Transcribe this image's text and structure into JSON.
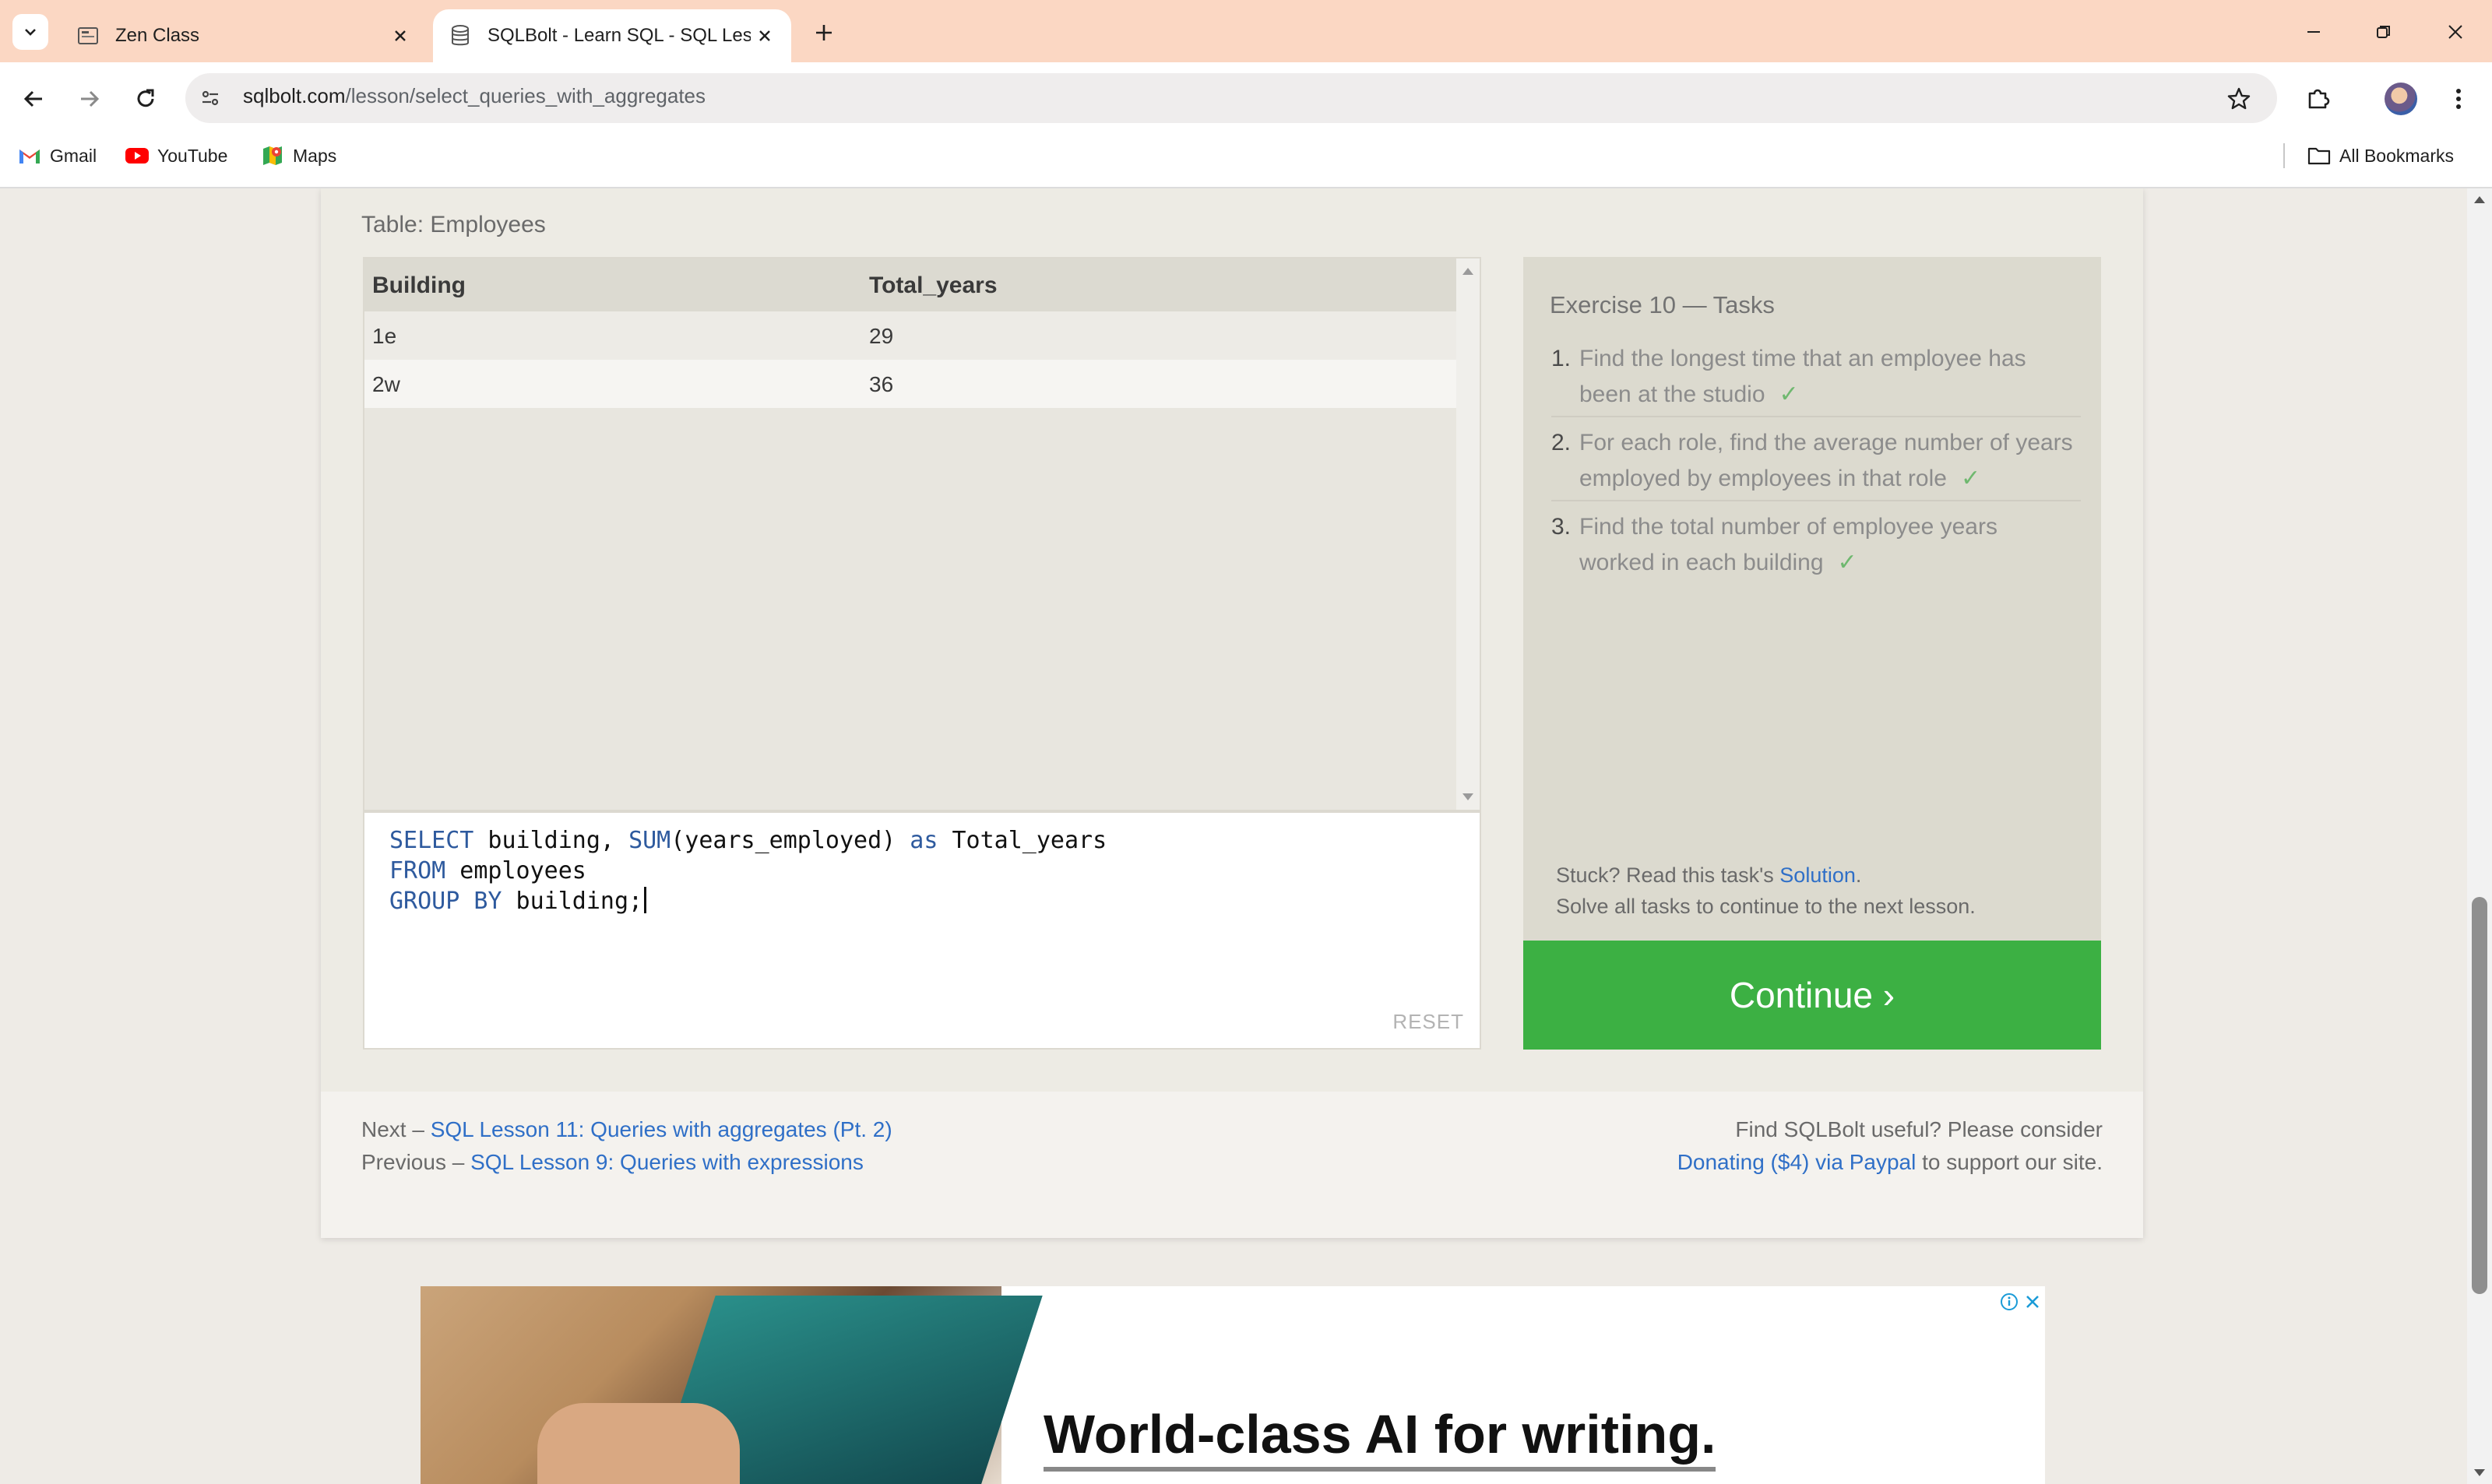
{
  "browser": {
    "tabs": [
      {
        "title": "Zen Class",
        "icon": "zen-class-favicon",
        "active": false
      },
      {
        "title": "SQLBolt - Learn SQL - SQL Less",
        "icon": "database-icon",
        "active": true
      }
    ],
    "url": {
      "host": "sqlbolt.com",
      "path": "/lesson/select_queries_with_aggregates"
    },
    "bookmarks": [
      {
        "label": "Gmail",
        "icon": "gmail-icon"
      },
      {
        "label": "YouTube",
        "icon": "youtube-icon"
      },
      {
        "label": "Maps",
        "icon": "maps-icon"
      }
    ],
    "all_bookmarks_label": "All Bookmarks"
  },
  "exercise": {
    "table_caption": "Table: Employees",
    "results": {
      "columns": [
        "Building",
        "Total_years"
      ],
      "rows": [
        [
          "1e",
          "29"
        ],
        [
          "2w",
          "36"
        ]
      ]
    },
    "query": {
      "line1": {
        "kw1": "SELECT",
        "t1": " building, ",
        "fn": "SUM",
        "t2": "(years_employed) ",
        "kw2": "as",
        "t3": " Total_years"
      },
      "line2": {
        "kw": "FROM",
        "t": " employees"
      },
      "line3": {
        "kw": "GROUP BY",
        "t": " building;"
      }
    },
    "reset_label": "RESET",
    "tasks_title": "Exercise 10 — Tasks",
    "tasks": [
      {
        "num": "1.",
        "text": "Find the longest time that an employee has been at the studio",
        "check": "✓"
      },
      {
        "num": "2.",
        "text": "For each role, find the average number of years employed by employees in that role",
        "check": "✓"
      },
      {
        "num": "3.",
        "text": "Find the total number of employee years worked in each building",
        "check": "✓"
      }
    ],
    "stuck": {
      "prefix": "Stuck? Read this task's ",
      "link": "Solution",
      "suffix": ".",
      "line2": "Solve all tasks to continue to the next lesson."
    },
    "continue_label": "Continue ›"
  },
  "footer": {
    "next_prefix": "Next – ",
    "next_link": "SQL Lesson 11: Queries with aggregates (Pt. 2)",
    "prev_prefix": "Previous – ",
    "prev_link": "SQL Lesson 9: Queries with expressions",
    "donate_line1": "Find SQLBolt useful? Please consider",
    "donate_link": "Donating ($4) via Paypal",
    "donate_suffix": " to support our site."
  },
  "ad": {
    "headline": "World-class AI for writing."
  },
  "colors": {
    "continue_green": "#3cb043",
    "link_blue": "#2f6fc7",
    "tab_bar": "#fbd7c3",
    "keyword_blue": "#2e5a9e"
  }
}
